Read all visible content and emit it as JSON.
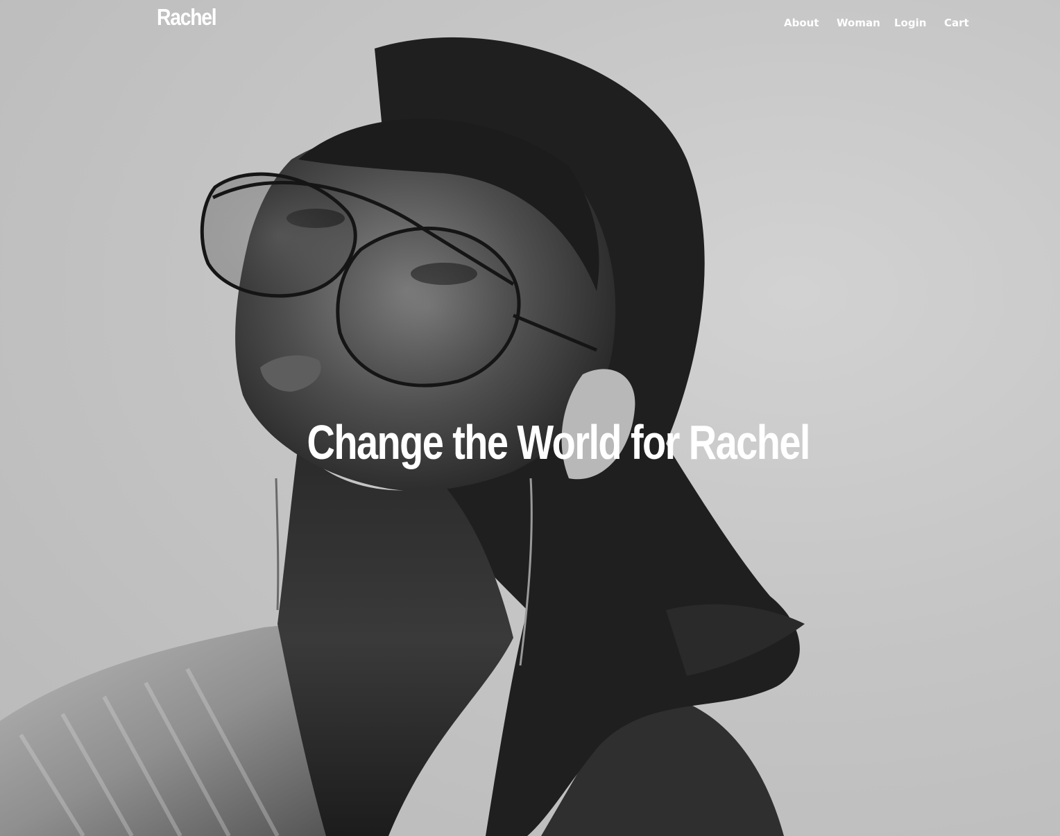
{
  "header": {
    "brand": "Rachel",
    "nav": [
      {
        "label": "About"
      },
      {
        "label": "Woman"
      },
      {
        "label": "Login"
      },
      {
        "label": "Cart"
      }
    ]
  },
  "hero": {
    "title": "Change the World for Rachel",
    "image": "black-and-white portrait of a woman wearing aviator sunglasses"
  },
  "colors": {
    "background": "#c4c4c4",
    "text": "#ffffff",
    "hair": "#1e1e1e"
  }
}
